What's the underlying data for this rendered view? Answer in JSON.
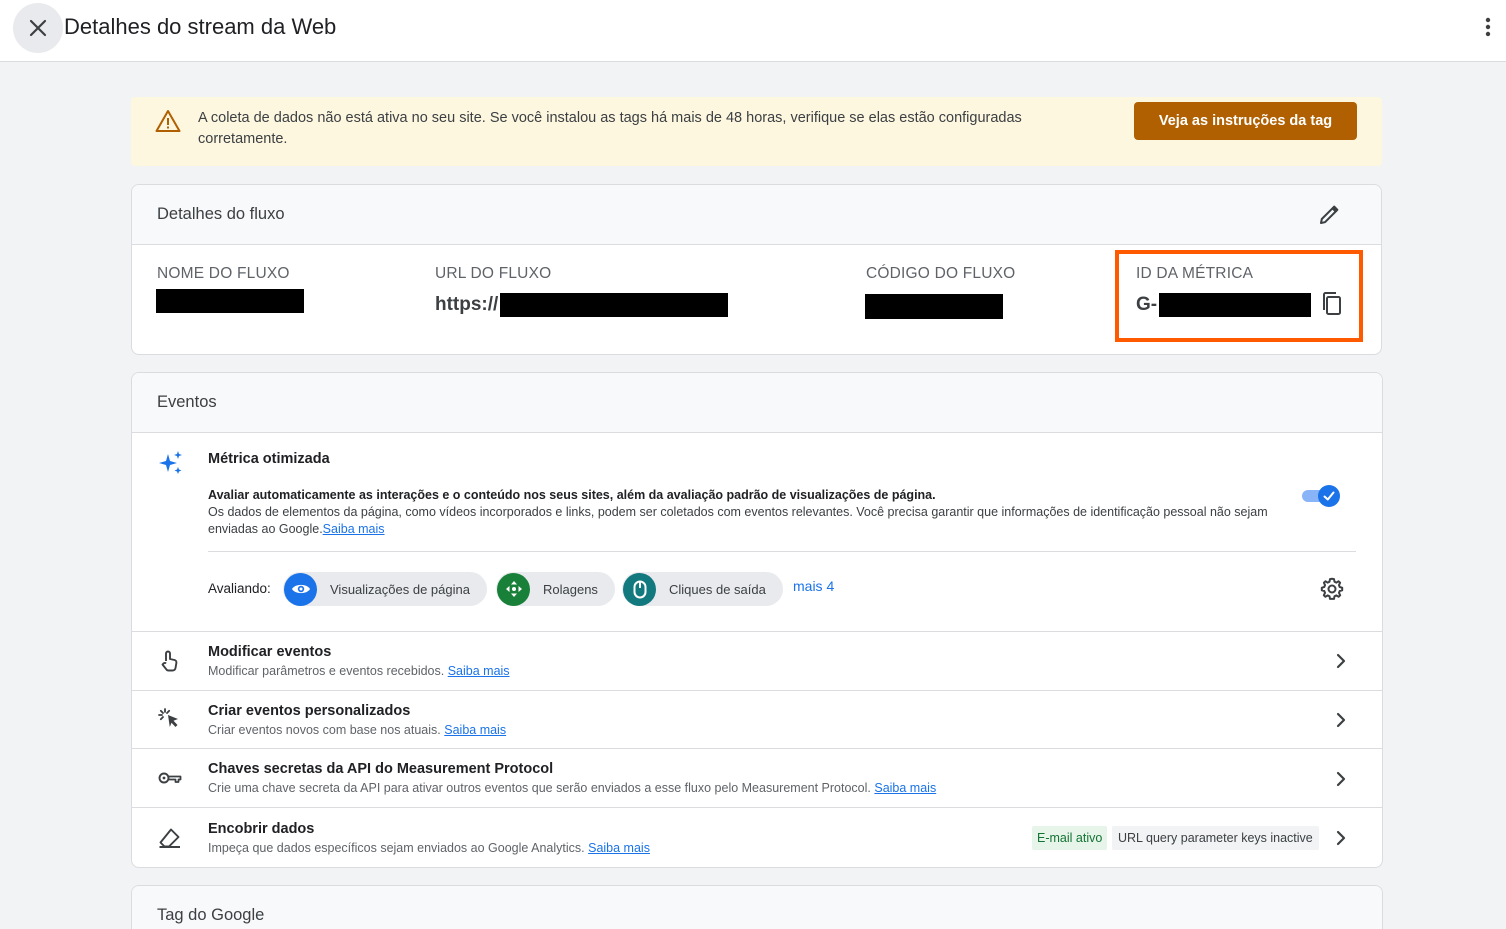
{
  "header": {
    "title": "Detalhes do stream da Web"
  },
  "banner": {
    "text": "A coleta de dados não está ativa no seu site. Se você instalou as tags há mais de 48 horas, verifique se elas estão configuradas corretamente.",
    "button_label": "Veja as instruções da tag"
  },
  "stream_details": {
    "title": "Detalhes do fluxo",
    "fields": [
      {
        "label": "NOME DO FLUXO",
        "value": ""
      },
      {
        "label": "URL DO FLUXO",
        "value": "https://"
      },
      {
        "label": "CÓDIGO DO FLUXO",
        "value": ""
      },
      {
        "label": "ID DA MÉTRICA",
        "value": "G-"
      }
    ]
  },
  "events": {
    "title": "Eventos",
    "enhanced": {
      "title": "Métrica otimizada",
      "desc_strong": "Avaliar automaticamente as interações e o conteúdo nos seus sites, além da avaliação padrão de visualizações de página.",
      "desc_rest": "Os dados de elementos da página, como vídeos incorporados e links, podem ser coletados com eventos relevantes. Você precisa garantir que informações de identificação pessoal não sejam enviadas ao Google.",
      "learn_more": "Saiba mais",
      "toggle_on": true,
      "measuring_label": "Avaliando:",
      "chips": [
        {
          "label": "Visualizações de página",
          "color": "#1a73e8",
          "icon": "eye-icon"
        },
        {
          "label": "Rolagens",
          "color": "#188038",
          "icon": "scroll-arrows-icon"
        },
        {
          "label": "Cliques de saída",
          "color": "#12797e",
          "icon": "mouse-icon"
        }
      ],
      "more": "mais 4"
    },
    "rows": [
      {
        "title": "Modificar eventos",
        "desc": "Modificar parâmetros e eventos recebidos.",
        "link": "Saiba mais",
        "icon": "touch-hand-icon"
      },
      {
        "title": "Criar eventos personalizados",
        "desc": "Criar eventos novos com base nos atuais.",
        "link": "Saiba mais",
        "icon": "click-sparkle-icon"
      },
      {
        "title": "Chaves secretas da API do Measurement Protocol",
        "desc": "Crie uma chave secreta da API para ativar outros eventos que serão enviados a esse fluxo pelo Measurement Protocol.",
        "link": "Saiba mais",
        "icon": "key-icon"
      },
      {
        "title": "Encobrir dados",
        "desc": "Impeça que dados específicos sejam enviados ao Google Analytics.",
        "link": "Saiba mais",
        "icon": "eraser-icon",
        "badges": [
          "E-mail ativo",
          "URL query parameter keys inactive"
        ]
      }
    ]
  },
  "google_tag": {
    "title": "Tag do Google"
  },
  "colors": {
    "accent": "#1a73e8",
    "banner_bg": "#fef7e0",
    "banner_button": "#b06000",
    "highlight": "#ff5a00"
  }
}
